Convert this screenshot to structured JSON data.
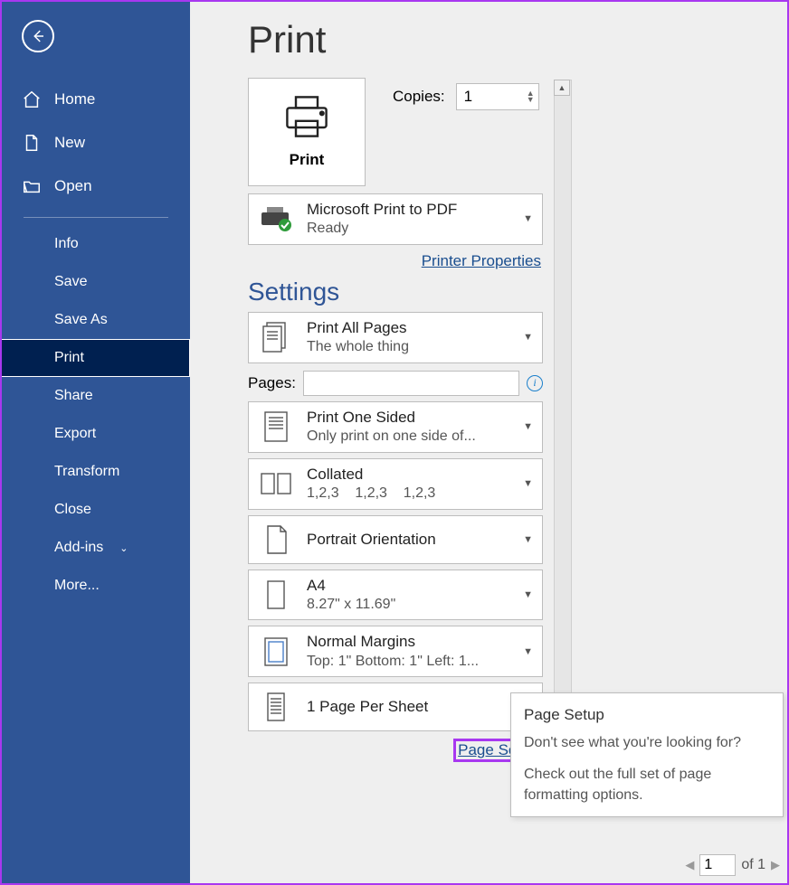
{
  "sidebar": {
    "items": [
      {
        "label": "Home",
        "icon": "home-icon",
        "type": "primary"
      },
      {
        "label": "New",
        "icon": "new-icon",
        "type": "primary"
      },
      {
        "label": "Open",
        "icon": "open-icon",
        "type": "primary"
      }
    ],
    "secondary": [
      {
        "label": "Info"
      },
      {
        "label": "Save"
      },
      {
        "label": "Save As"
      },
      {
        "label": "Print",
        "active": true
      },
      {
        "label": "Share"
      },
      {
        "label": "Export"
      },
      {
        "label": "Transform"
      },
      {
        "label": "Close"
      },
      {
        "label": "Add-ins",
        "chevron": true
      },
      {
        "label": "More..."
      }
    ]
  },
  "page": {
    "title": "Print",
    "print_button": "Print",
    "copies_label": "Copies:",
    "copies_value": "1"
  },
  "printer": {
    "name": "Microsoft Print to PDF",
    "status": "Ready",
    "properties_link": "Printer Properties"
  },
  "settings": {
    "heading": "Settings",
    "print_range": {
      "title": "Print All Pages",
      "sub": "The whole thing"
    },
    "pages_label": "Pages:",
    "pages_value": "",
    "sides": {
      "title": "Print One Sided",
      "sub": "Only print on one side of..."
    },
    "collate": {
      "title": "Collated",
      "sub": "1,2,3    1,2,3    1,2,3"
    },
    "orientation": {
      "title": "Portrait Orientation"
    },
    "paper": {
      "title": "A4",
      "sub": "8.27\" x 11.69\""
    },
    "margins": {
      "title": "Normal Margins",
      "sub": "Top: 1\" Bottom: 1\" Left: 1..."
    },
    "per_sheet": {
      "title": "1 Page Per Sheet"
    },
    "page_setup_link": "Page Setup"
  },
  "tooltip": {
    "title": "Page Setup",
    "line1": "Don't see what you're looking for?",
    "line2": "Check out the full set of page formatting options."
  },
  "pagenav": {
    "current": "1",
    "of_label": "of 1"
  }
}
